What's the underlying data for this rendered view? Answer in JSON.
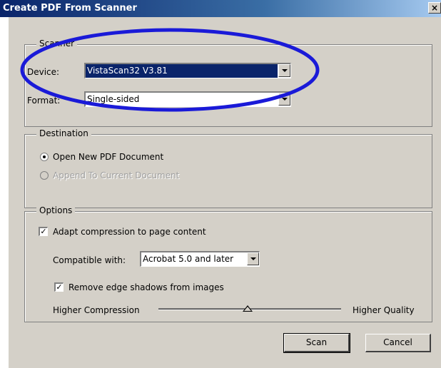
{
  "window": {
    "title": "Create PDF From Scanner",
    "close_label": "×"
  },
  "scanner": {
    "legend": "Scanner",
    "device_label": "Device:",
    "device_value": "VistaScan32 V3.81",
    "format_label": "Format:",
    "format_value": "Single-sided"
  },
  "destination": {
    "legend": "Destination",
    "option_new": "Open New PDF Document",
    "option_append": "Append To Current Document",
    "selected": "new"
  },
  "options": {
    "legend": "Options",
    "adapt_label": "Adapt compression to page content",
    "adapt_checked": true,
    "compatible_label": "Compatible with:",
    "compatible_value": "Acrobat 5.0 and later",
    "remove_shadows_label": "Remove edge shadows from images",
    "remove_shadows_checked": true,
    "slider_left_label": "Higher Compression",
    "slider_right_label": "Higher Quality"
  },
  "buttons": {
    "scan": "Scan",
    "cancel": "Cancel"
  },
  "colors": {
    "annotation": "#1a1ad8",
    "titlebar": "#0a246a",
    "dialog_bg": "#d4d0c8"
  }
}
